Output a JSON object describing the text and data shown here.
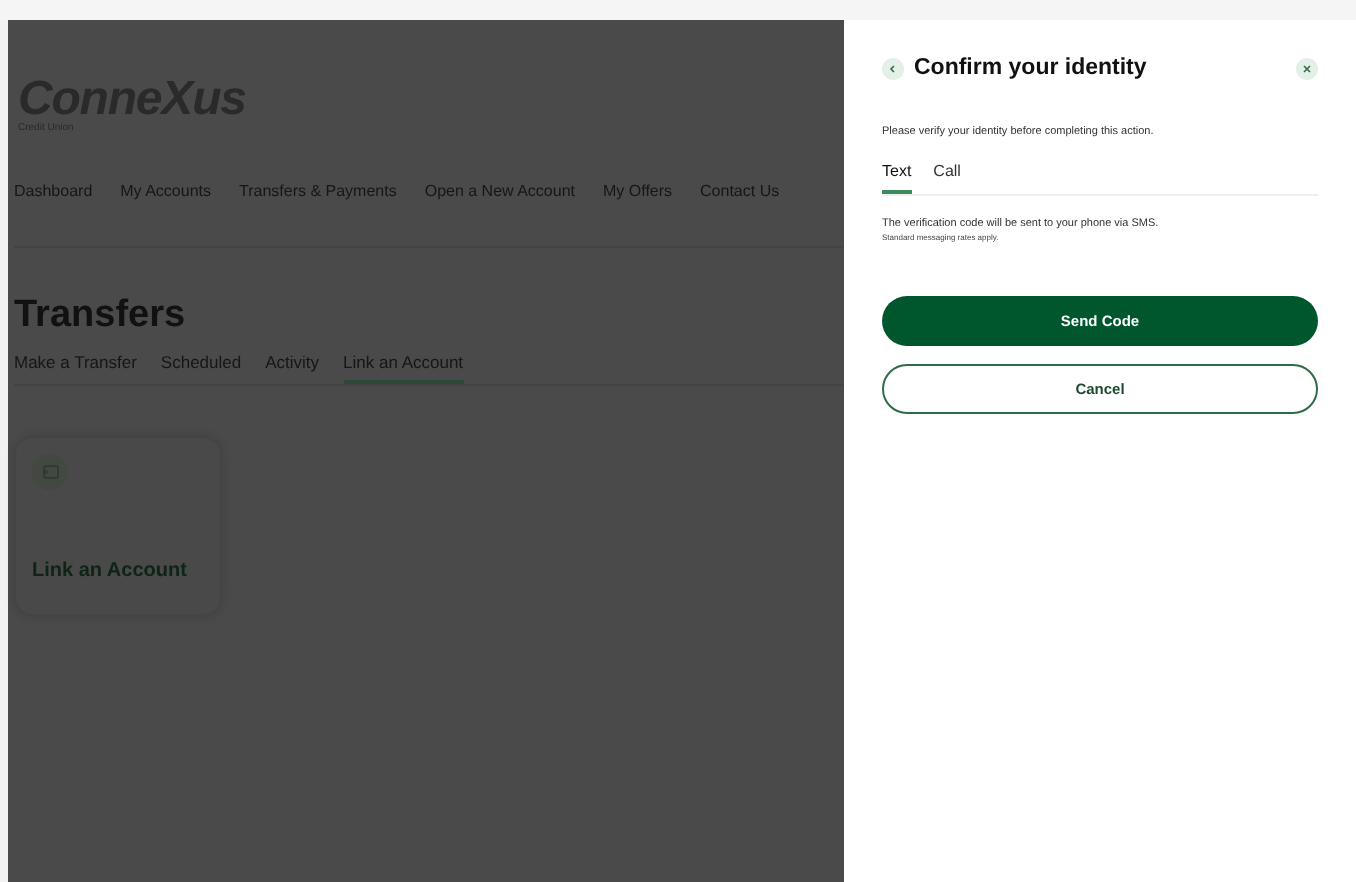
{
  "logo": {
    "name": "ConneXus",
    "subtitle": "Credit Union"
  },
  "nav": [
    {
      "label": "Dashboard"
    },
    {
      "label": "My Accounts"
    },
    {
      "label": "Transfers & Payments"
    },
    {
      "label": "Open a New Account"
    },
    {
      "label": "My Offers"
    },
    {
      "label": "Contact Us"
    }
  ],
  "page_title": "Transfers",
  "tabs": [
    {
      "label": "Make a Transfer",
      "selected": false
    },
    {
      "label": "Scheduled",
      "selected": false
    },
    {
      "label": "Activity",
      "selected": false
    },
    {
      "label": "Link an Account",
      "selected": true
    }
  ],
  "card": {
    "title": "Link an Account"
  },
  "dialog": {
    "title": "Confirm your identity",
    "intro": "Please verify your identity before completing this action.",
    "tabs": [
      {
        "label": "Text",
        "selected": true
      },
      {
        "label": "Call",
        "selected": false
      }
    ],
    "message": "The verification code will be sent to your phone via SMS.",
    "note": "Standard messaging rates apply.",
    "buttons": [
      {
        "label": "Send Code",
        "kind": "primary"
      },
      {
        "label": "Cancel",
        "kind": "secondary"
      }
    ]
  }
}
